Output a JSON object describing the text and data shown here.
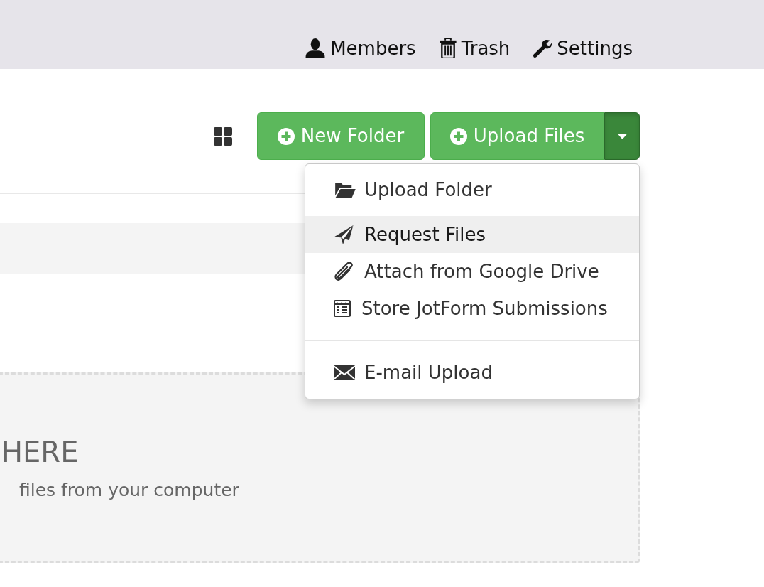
{
  "top_nav": {
    "items": [
      {
        "label": "Members",
        "kind": "members"
      },
      {
        "label": "Trash",
        "kind": "trash"
      },
      {
        "label": "Settings",
        "kind": "settings"
      }
    ]
  },
  "toolbar": {
    "buttons": [
      {
        "label": "New Folder",
        "split": false
      },
      {
        "label": "Upload Files",
        "split": true
      }
    ]
  },
  "upload_menu": {
    "expanded": true,
    "groups": [
      {
        "items": [
          {
            "label": "Upload Folder",
            "kind": "folder",
            "selected": false
          },
          {
            "label": "Request Files",
            "kind": "request",
            "selected": true
          },
          {
            "label": "Attach from Google Drive",
            "kind": "attach",
            "selected": false
          },
          {
            "label": "Store JotForm Submissions",
            "kind": "form",
            "selected": false
          }
        ]
      },
      {
        "items": [
          {
            "label": "E-mail Upload",
            "kind": "email",
            "selected": false
          }
        ]
      }
    ]
  },
  "drop_zone": {
    "title": "HERE",
    "subtitle": "files from your computer"
  }
}
